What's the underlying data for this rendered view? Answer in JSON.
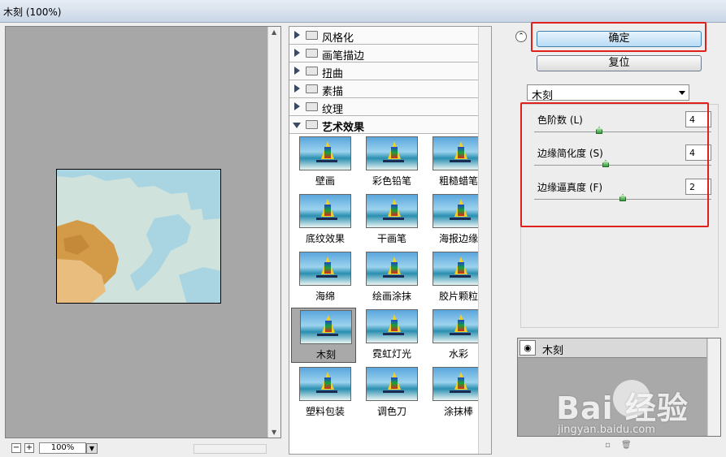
{
  "window": {
    "title": "木刻 (100%)"
  },
  "preview": {
    "zoom_value": "100%",
    "zoom_out_icon": "minus-icon",
    "zoom_in_icon": "plus-icon"
  },
  "categories": [
    {
      "label": "风格化",
      "expanded": false
    },
    {
      "label": "画笔描边",
      "expanded": false
    },
    {
      "label": "扭曲",
      "expanded": false
    },
    {
      "label": "素描",
      "expanded": false
    },
    {
      "label": "纹理",
      "expanded": false
    },
    {
      "label": "艺术效果",
      "expanded": true
    }
  ],
  "filters": [
    {
      "label": "壁画",
      "selected": false
    },
    {
      "label": "彩色铅笔",
      "selected": false
    },
    {
      "label": "粗糙蜡笔",
      "selected": false
    },
    {
      "label": "底纹效果",
      "selected": false
    },
    {
      "label": "干画笔",
      "selected": false
    },
    {
      "label": "海报边缘",
      "selected": false
    },
    {
      "label": "海绵",
      "selected": false
    },
    {
      "label": "绘画涂抹",
      "selected": false
    },
    {
      "label": "胶片颗粒",
      "selected": false
    },
    {
      "label": "木刻",
      "selected": true
    },
    {
      "label": "霓虹灯光",
      "selected": false
    },
    {
      "label": "水彩",
      "selected": false
    },
    {
      "label": "塑料包装",
      "selected": false
    },
    {
      "label": "调色刀",
      "selected": false
    },
    {
      "label": "涂抹棒",
      "selected": false
    }
  ],
  "buttons": {
    "ok": "确定",
    "reset": "复位"
  },
  "filter_select": {
    "value": "木刻"
  },
  "params": [
    {
      "label": "色阶数 (L)",
      "value": "4",
      "level": 0.36
    },
    {
      "label": "边缘简化度 (S)",
      "value": "4",
      "level": 0.4
    },
    {
      "label": "边缘逼真度 (F)",
      "value": "2",
      "level": 0.5
    }
  ],
  "layers": [
    {
      "name": "木刻",
      "visible_icon": "eye-icon"
    }
  ],
  "watermark": {
    "brand": "Bai 经验",
    "url": "jingyan.baidu.com"
  },
  "colors": {
    "highlight_red": "#e0201c",
    "selected_thumb": "#a9a9a9"
  }
}
